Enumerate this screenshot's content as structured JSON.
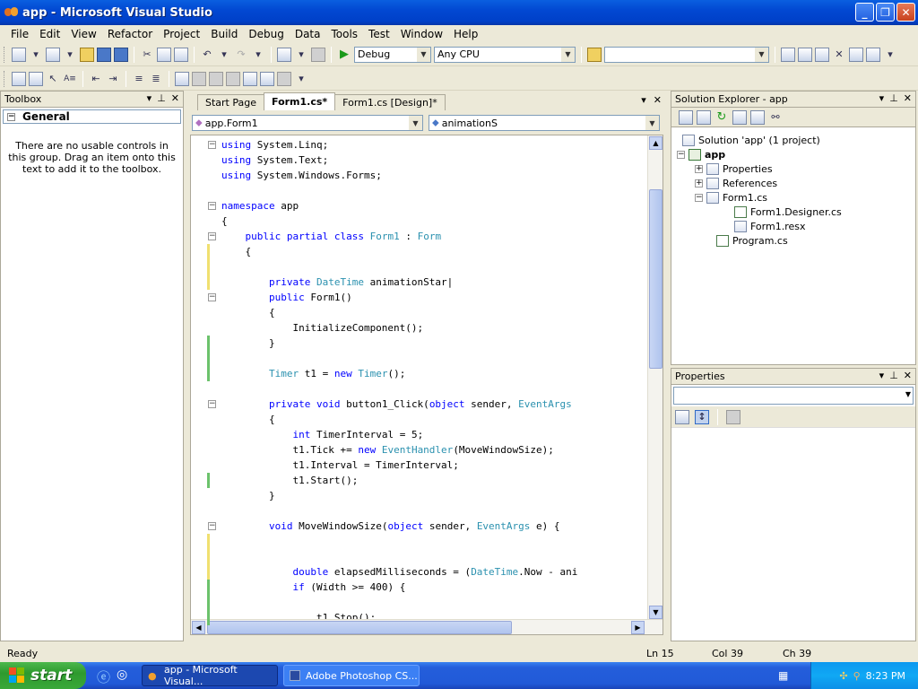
{
  "window": {
    "title": "app - Microsoft Visual Studio"
  },
  "menu": [
    "File",
    "Edit",
    "View",
    "Refactor",
    "Project",
    "Build",
    "Debug",
    "Data",
    "Tools",
    "Test",
    "Window",
    "Help"
  ],
  "toolbar": {
    "config": "Debug",
    "platform": "Any CPU",
    "find": ""
  },
  "toolbox": {
    "title": "Toolbox",
    "group": "General",
    "empty_text": "There are no usable controls in this group. Drag an item onto this text to add it to the toolbox."
  },
  "tabs": [
    "Start Page",
    "Form1.cs*",
    "Form1.cs [Design]*"
  ],
  "nav": {
    "class_combo": "app.Form1",
    "member_combo": "animationS"
  },
  "code_lines": [
    [
      [
        "kw",
        "using"
      ],
      [
        "",
        " System.Linq;"
      ]
    ],
    [
      [
        "kw",
        "using"
      ],
      [
        "",
        " System.Text;"
      ]
    ],
    [
      [
        "kw",
        "using"
      ],
      [
        "",
        " System.Windows.Forms;"
      ]
    ],
    [],
    [
      [
        "kw",
        "namespace"
      ],
      [
        "",
        " app"
      ]
    ],
    [
      [
        "",
        "{"
      ]
    ],
    [
      [
        "",
        "    "
      ],
      [
        "kw",
        "public"
      ],
      [
        "",
        " "
      ],
      [
        "kw",
        "partial"
      ],
      [
        "",
        " "
      ],
      [
        "kw",
        "class"
      ],
      [
        "",
        " "
      ],
      [
        "ty",
        "Form1"
      ],
      [
        "",
        " : "
      ],
      [
        "ty",
        "Form"
      ]
    ],
    [
      [
        "",
        "    {"
      ]
    ],
    [],
    [
      [
        "",
        "        "
      ],
      [
        "kw",
        "private"
      ],
      [
        "",
        " "
      ],
      [
        "ty",
        "DateTime"
      ],
      [
        "",
        " animationStar|"
      ]
    ],
    [
      [
        "",
        "        "
      ],
      [
        "kw",
        "public"
      ],
      [
        "",
        " Form1()"
      ]
    ],
    [
      [
        "",
        "        {"
      ]
    ],
    [
      [
        "",
        "            InitializeComponent();"
      ]
    ],
    [
      [
        "",
        "        }"
      ]
    ],
    [],
    [
      [
        "",
        "        "
      ],
      [
        "ty",
        "Timer"
      ],
      [
        "",
        " t1 = "
      ],
      [
        "kw",
        "new"
      ],
      [
        "",
        " "
      ],
      [
        "ty",
        "Timer"
      ],
      [
        "",
        "();"
      ]
    ],
    [],
    [
      [
        "",
        "        "
      ],
      [
        "kw",
        "private"
      ],
      [
        "",
        " "
      ],
      [
        "kw",
        "void"
      ],
      [
        "",
        " button1_Click("
      ],
      [
        "kw",
        "object"
      ],
      [
        "",
        " sender, "
      ],
      [
        "ty",
        "EventArgs"
      ]
    ],
    [
      [
        "",
        "        {"
      ]
    ],
    [
      [
        "",
        "            "
      ],
      [
        "kw",
        "int"
      ],
      [
        "",
        " TimerInterval = 5;"
      ]
    ],
    [
      [
        "",
        "            t1.Tick += "
      ],
      [
        "kw",
        "new"
      ],
      [
        "",
        " "
      ],
      [
        "ty",
        "EventHandler"
      ],
      [
        "",
        "(MoveWindowSize);"
      ]
    ],
    [
      [
        "",
        "            t1.Interval = TimerInterval;"
      ]
    ],
    [
      [
        "",
        "            t1.Start();"
      ]
    ],
    [
      [
        "",
        "        }"
      ]
    ],
    [],
    [
      [
        "",
        "        "
      ],
      [
        "kw",
        "void"
      ],
      [
        "",
        " MoveWindowSize("
      ],
      [
        "kw",
        "object"
      ],
      [
        "",
        " sender, "
      ],
      [
        "ty",
        "EventArgs"
      ],
      [
        "",
        " e) {"
      ]
    ],
    [],
    [],
    [
      [
        "",
        "            "
      ],
      [
        "kw",
        "double"
      ],
      [
        "",
        " elapsedMilliseconds = ("
      ],
      [
        "ty",
        "DateTime"
      ],
      [
        "",
        ".Now - ani"
      ]
    ],
    [
      [
        "",
        "            "
      ],
      [
        "kw",
        "if"
      ],
      [
        "",
        " (Width >= 400) {"
      ]
    ],
    [],
    [
      [
        "",
        "                t1.Stop();"
      ]
    ]
  ],
  "solution_explorer": {
    "title": "Solution Explorer - app",
    "items": [
      {
        "label": "Solution 'app' (1 project)"
      },
      {
        "label": "app"
      },
      {
        "label": "Properties"
      },
      {
        "label": "References"
      },
      {
        "label": "Form1.cs"
      },
      {
        "label": "Form1.Designer.cs"
      },
      {
        "label": "Form1.resx"
      },
      {
        "label": "Program.cs"
      }
    ]
  },
  "properties": {
    "title": "Properties"
  },
  "status": {
    "ready": "Ready",
    "ln": "Ln 15",
    "col": "Col 39",
    "ch": "Ch 39"
  },
  "taskbar": {
    "start": "start",
    "tasks": [
      "app - Microsoft Visual...",
      "Adobe Photoshop CS..."
    ],
    "clock": "8:23 PM"
  }
}
